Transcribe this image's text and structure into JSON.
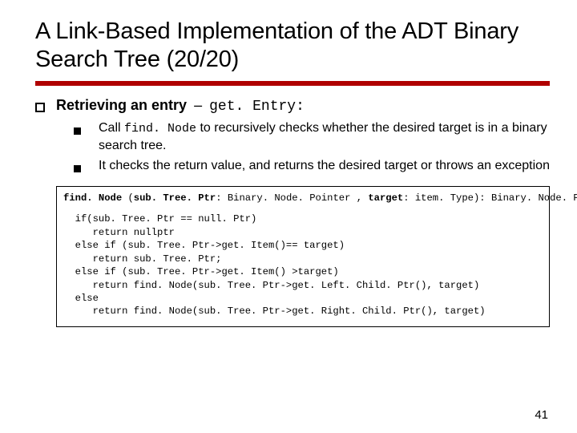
{
  "title": "A Link-Based Implementation of the ADT Binary Search Tree (20/20)",
  "lvl1": {
    "label": "Retrieving an entry",
    "dash": "–",
    "code": "get. Entry",
    "colon": ":"
  },
  "sub": [
    {
      "pre": "Call ",
      "code": "find. Node",
      "post": " to recursively checks whether the desired target is in a binary search tree."
    },
    {
      "pre": "",
      "code": "",
      "post": "It checks the return value, and returns the desired target or throws an exception"
    }
  ],
  "code_sig": {
    "fn": "find. Node",
    "open": " (",
    "p1n": "sub. Tree. Ptr",
    "p1t": ": Binary. Node. Pointer , ",
    "p2n": "target",
    "p2t": ": item. Type): Binary. Node. Pointer"
  },
  "code_body_lines": [
    "  if(sub. Tree. Ptr == null. Ptr)",
    "     return nullptr",
    "  else if (sub. Tree. Ptr->get. Item()== target)",
    "     return sub. Tree. Ptr;",
    "  else if (sub. Tree. Ptr->get. Item() >target)",
    "     return find. Node(sub. Tree. Ptr->get. Left. Child. Ptr(), target)",
    "  else",
    "     return find. Node(sub. Tree. Ptr->get. Right. Child. Ptr(), target)"
  ],
  "page_number": "41"
}
